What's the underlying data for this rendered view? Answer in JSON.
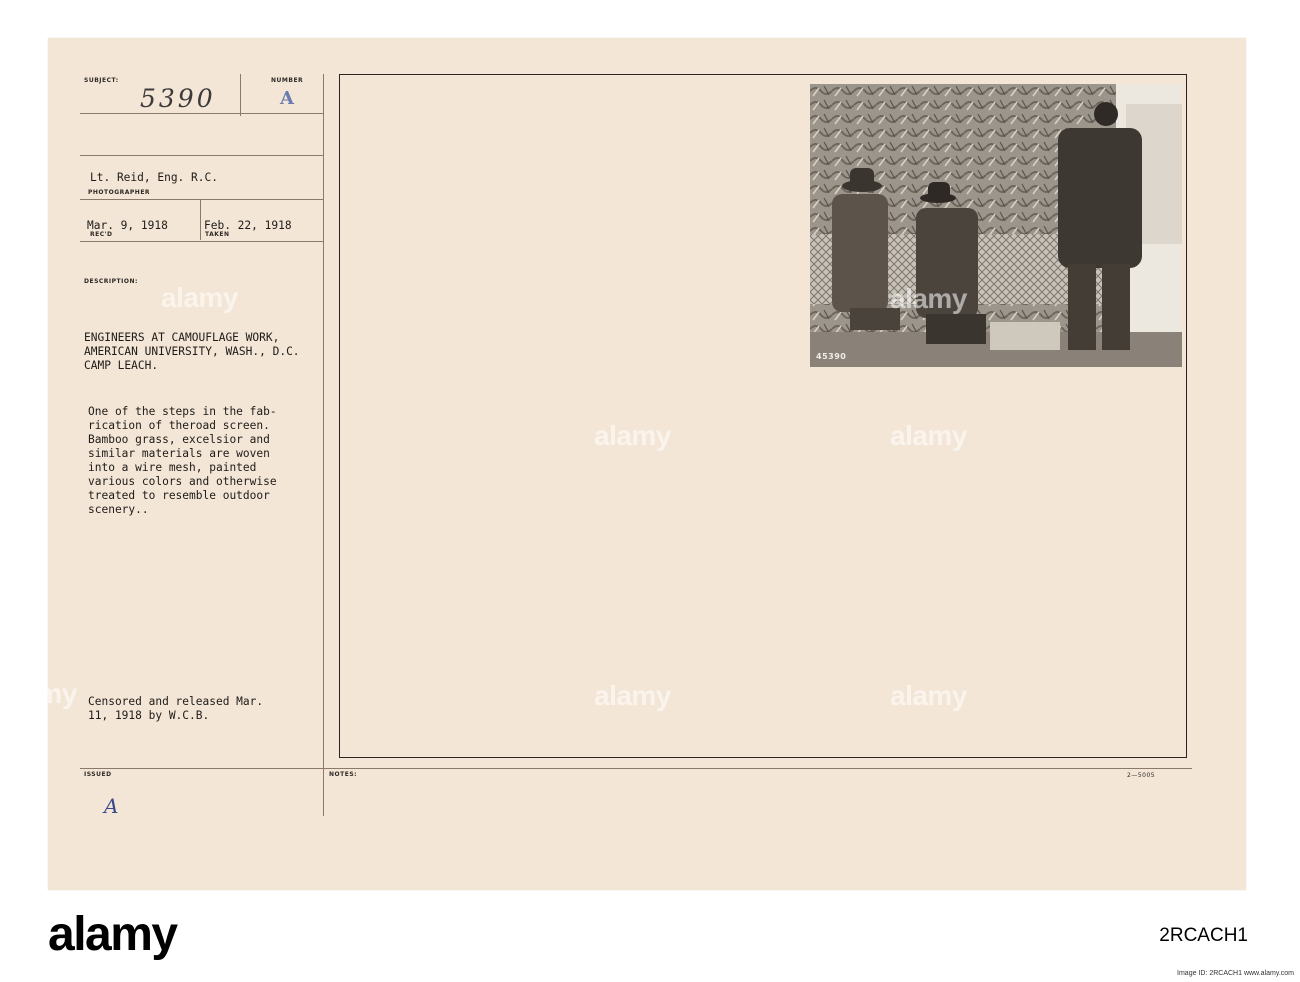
{
  "labels": {
    "subject": "SUBJECT:",
    "number": "NUMBER",
    "photographer": "PHOTOGRAPHER",
    "recd": "REC'D",
    "taken": "TAKEN",
    "description": "DESCRIPTION:",
    "issued": "ISSUED",
    "notes": "NOTES:"
  },
  "record": {
    "subject_number": "5390",
    "number_letter": "A",
    "photographer_name": "Lt. Reid, Eng. R.C.",
    "received_date": "Mar. 9, 1918",
    "taken_date": "Feb. 22, 1918",
    "title_lines": [
      "ENGINEERS AT CAMOUFLAGE WORK,",
      "AMERICAN UNIVERSITY, WASH., D.C.",
      "CAMP LEACH."
    ],
    "description_lines": [
      "One of the steps in the fab-",
      "rication of theroad screen.",
      "Bamboo grass, excelsior and",
      "similar materials are woven",
      "into a wire mesh, painted",
      "various colors and otherwise",
      "treated to resemble outdoor",
      "scenery.."
    ],
    "censor_lines": [
      "Censored and released Mar.",
      "11, 1918 by W.C.B."
    ],
    "issued_letter": "A",
    "form_number": "2—5005",
    "photo_caption": "45390"
  },
  "watermark": {
    "text": "alamy",
    "logo_text": "alamy",
    "stock_id": "2RCACH1",
    "side_id": "Image ID: 2RCACH1 www.alamy.com"
  }
}
